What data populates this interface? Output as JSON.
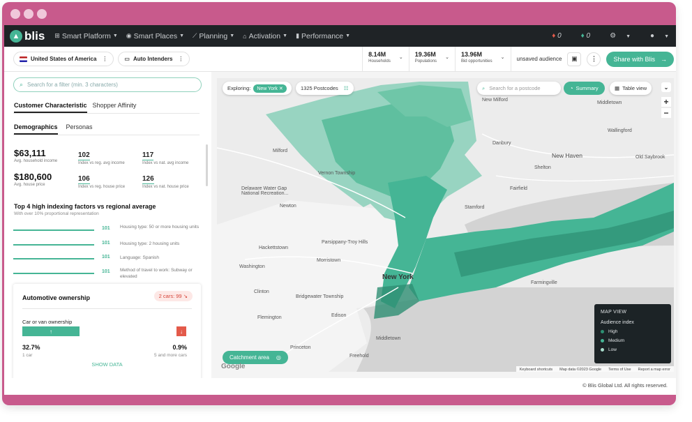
{
  "nav": {
    "logo": "blis",
    "items": [
      {
        "icon": "grid-icon",
        "glyph": "⊞",
        "label": "Smart Platform"
      },
      {
        "icon": "pin-icon",
        "glyph": "◉",
        "label": "Smart Places"
      },
      {
        "icon": "chart-icon",
        "glyph": "⟋",
        "label": "Planning"
      },
      {
        "icon": "home-icon",
        "glyph": "⌂",
        "label": "Activation"
      },
      {
        "icon": "bars-icon",
        "glyph": "▮",
        "label": "Performance"
      }
    ],
    "flame_red_count": "0",
    "flame_green_count": "0"
  },
  "toolbar": {
    "country": "United States of America",
    "audience": "Auto Intenders",
    "stats": [
      {
        "value": "8.14M",
        "label": "Households"
      },
      {
        "value": "19.36M",
        "label": "Populations"
      },
      {
        "value": "13.96M",
        "label": "Bid opportunities"
      }
    ],
    "unsaved": "unsaved audience",
    "share": "Share with Blis"
  },
  "left": {
    "filter_placeholder": "Search for a filter (min. 3 characters)",
    "tabs": [
      "Customer Characteristic",
      "Shopper Affinity"
    ],
    "subtabs": [
      "Demographics",
      "Personas"
    ],
    "income": {
      "value": "$63,111",
      "label": "Avg. household income"
    },
    "income_reg": {
      "value": "102",
      "label": "Index vs reg. avg income"
    },
    "income_nat": {
      "value": "117",
      "label": "Index vs nat. avg income"
    },
    "house": {
      "value": "$180,600",
      "label": "Avg. house price"
    },
    "house_reg": {
      "value": "106",
      "label": "Index vs reg. house price"
    },
    "house_nat": {
      "value": "126",
      "label": "Index vs nat. house price"
    },
    "factors_title": "Top 4 high indexing factors vs regional average",
    "factors_sub": "With over 10% proportional representation",
    "factors": [
      {
        "value": "101",
        "label": "Housing type: 50 or more housing units"
      },
      {
        "value": "101",
        "label": "Housing type: 2 housing units"
      },
      {
        "value": "101",
        "label": "Language: Spanish"
      },
      {
        "value": "101",
        "label": "Method of travel to work: Subway or elevated"
      }
    ],
    "card": {
      "title": "Automotive ownership",
      "badge": "2 cars: 99",
      "subtitle": "Car or van ownership",
      "left_pct": "32.7%",
      "left_label": "1 car",
      "right_pct": "0.9%",
      "right_label": "5 and more cars",
      "show": "SHOW DATA"
    }
  },
  "map": {
    "exploring": "Exploring:",
    "chip": "New York ✕",
    "postcodes": "1325 Postcodes",
    "search_placeholder": "Search for a postcode",
    "summary": "Summary",
    "table": "Table view",
    "legend_title": "MAP VIEW",
    "legend_sub": "Audience index",
    "legend": [
      {
        "label": "High",
        "color": "#2e8f73"
      },
      {
        "label": "Medium",
        "color": "#45b595"
      },
      {
        "label": "Low",
        "color": "#a8dccb"
      }
    ],
    "catchment": "Catchment area",
    "google": "Google",
    "attrib": [
      "Keyboard shortcuts",
      "Map data ©2023 Google",
      "Terms of Use",
      "Report a map error"
    ],
    "labels": {
      "new_york": "New York",
      "new_haven": "New Haven",
      "stamford": "Stamford",
      "newton": "Newton",
      "morristown": "Morristown",
      "hackettstown": "Hackettstown",
      "washington": "Washington",
      "flemington": "Flemington",
      "clinton": "Clinton",
      "princeton": "Princeton",
      "edison": "Edison",
      "middletown": "Middletown",
      "milford": "Milford",
      "new_milford": "New Milford",
      "middletown_ct": "Middletown",
      "fairfield": "Fairfield",
      "danbury": "Danbury",
      "vernon": "Vernon Township",
      "parsippany": "Parsippany-Troy Hills",
      "bridgewater": "Bridgewater Township",
      "delaware": "Delaware Water Gap National Recreation...",
      "wallingford": "Wallingford",
      "old_saybrook": "Old Saybrook",
      "shelton": "Shelton",
      "farmingville": "Farmingville",
      "freehold": "Freehold"
    }
  },
  "footer": "© Blis Global Ltd. All rights reserved."
}
